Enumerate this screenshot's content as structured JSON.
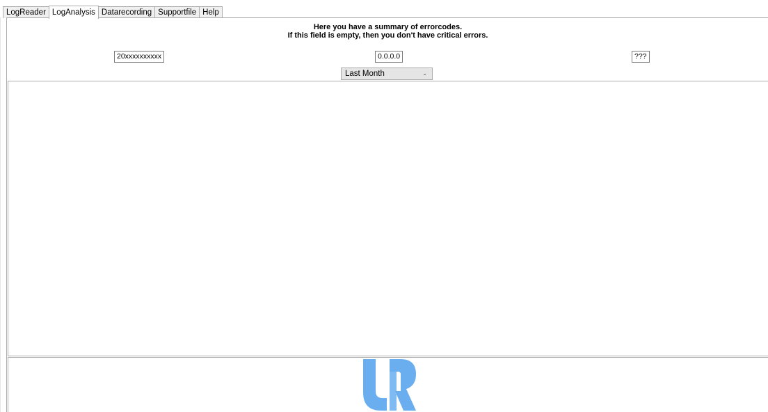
{
  "tabs": [
    {
      "label": "LogReader"
    },
    {
      "label": "LogAnalysis",
      "active": true
    },
    {
      "label": "Datarecording"
    },
    {
      "label": "Supportfile"
    },
    {
      "label": "Help"
    }
  ],
  "summary": {
    "line1": "Here you have a summary of errorcodes.",
    "line2": "If this field is empty, then you don't have critical errors."
  },
  "fields": {
    "serial": "20xxxxxxxxxx",
    "ip": "0.0.0.0",
    "version": "???"
  },
  "period_select": {
    "selected": "Last Month"
  },
  "icons": {
    "dropdown": "chevron-down-icon",
    "logo": "ur-logo"
  },
  "colors": {
    "logo": "#6aaef0",
    "border": "#adadad",
    "dropdown_bg": "#e5e5e5"
  }
}
